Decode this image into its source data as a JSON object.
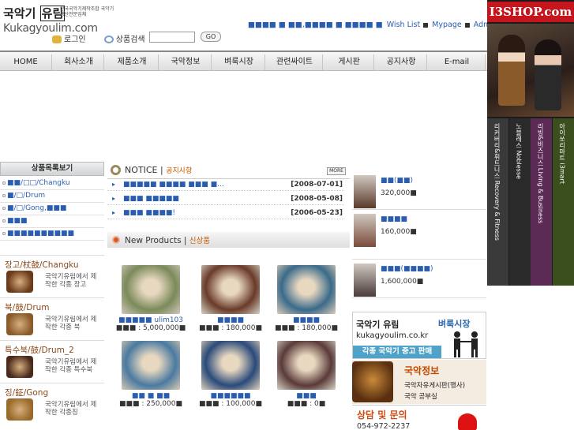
{
  "logo": {
    "main_a": "국악기",
    "main_b": "유림",
    "sub": "한국국악기제작조합 국악기생산전문업체",
    "domain": "Kukagyoulim.com"
  },
  "toplinks": {
    "blocks_a": "■■■■ ■ ■■,■■■■ ■ ■■■■ ■",
    "wishlist": "Wish List",
    "mypage": "Mypage",
    "admin": "Admin"
  },
  "login": {
    "login_label": "로그인",
    "search_label": "상품검색",
    "search_value": "",
    "go_label": "GO"
  },
  "nav": [
    "HOME",
    "회사소개",
    "제품소개",
    "국악정보",
    "벼룩시장",
    "관련싸이트",
    "게시판",
    "공지사항",
    "E-mail"
  ],
  "banner": {
    "brand": "I3SHOP.com",
    "stripes": [
      {
        "text": "리커버리&휘트니스 Recovery & Fitness",
        "color": "#3a3a3a"
      },
      {
        "text": "노블레스 Noblesse",
        "color": "#2a2a2a"
      },
      {
        "text": "리빙&비즈니스 Living & Business",
        "color": "#5b2a55"
      },
      {
        "text": "아이쏘리마트 i3mart",
        "color": "#3b4f1e"
      }
    ]
  },
  "categories": {
    "header": "상품목록보기",
    "rows": [
      "■■/□□/Changku",
      "■/□/Drum",
      "■/□/Gong,■■■",
      "■■■",
      "■■■■■■■■■■"
    ],
    "boxes": [
      {
        "title": "장고/杖鼓/Changku",
        "desc": "국악기유림에서 제작한 각종 장고",
        "color": "#6b3a1a"
      },
      {
        "title": "북/鼓/Drum",
        "desc": "국악기유림에서 제작한 각종 북",
        "color": "#8a5a2a"
      },
      {
        "title": "특수북/鼓/Drum_2",
        "desc": "국악기유림에서 제작한 각종 특수북",
        "color": "#4a2a1a"
      },
      {
        "title": "징/鉦/Gong",
        "desc": "국악기유림에서 제작한 각종징",
        "color": "#9a6a2a"
      }
    ]
  },
  "notice": {
    "title": "NOTICE",
    "title_kr": "공지사항",
    "more": "MORE",
    "items": [
      {
        "title": "■■■■■ ■■■■ ■■■ ■...",
        "date": "[2008-07-01]"
      },
      {
        "title": "■■■ ■■■■■",
        "date": "[2008-05-08]"
      },
      {
        "title": "■■■ ■■■■!",
        "date": "[2006-05-23]"
      }
    ]
  },
  "new_products": {
    "title": "New Products",
    "title_kr": "신상품",
    "items": [
      {
        "name": "■■■■■ ulim103",
        "price": "■■■ : 5,000,000■",
        "color": "#7a8a5a"
      },
      {
        "name": "■■■■",
        "price": "■■■ : 180,000■",
        "color": "#6a3a2a"
      },
      {
        "name": "■■■■",
        "price": "■■■ : 180,000■",
        "color": "#3a6a8a"
      },
      {
        "name": "■■ ■ ■■",
        "price": "■■■ : 250,000■",
        "color": "#4a7aa0"
      },
      {
        "name": "■■■■■■",
        "price": "■■■ : 100,000■",
        "color": "#2a4a7a"
      },
      {
        "name": "■■■",
        "price": "■■■ : 0■",
        "color": "#5a3a3a"
      }
    ]
  },
  "side_products": [
    {
      "name": "■■(■■)",
      "price": "320,000■",
      "color": "#5a3a2a"
    },
    {
      "name": "■■■■",
      "price": "160,000■",
      "color": "#7a4a3a"
    },
    {
      "name": "■■■(■■■■)",
      "price": "1,600,000■",
      "color": "#4a3a3a"
    }
  ],
  "ad_market": {
    "line1": "국악기 유림",
    "line1b": "벼룩시장",
    "line2": "kukagyoulim.co.kr",
    "bar": "각종 국악기 중고 판매"
  },
  "ad_info": {
    "title": "국악정보",
    "line1": "국악자유게시판(행사)",
    "line2": "국악 공부실"
  },
  "ad_contact": {
    "title": "상담 및 문의",
    "phone": "054-972-2237"
  }
}
